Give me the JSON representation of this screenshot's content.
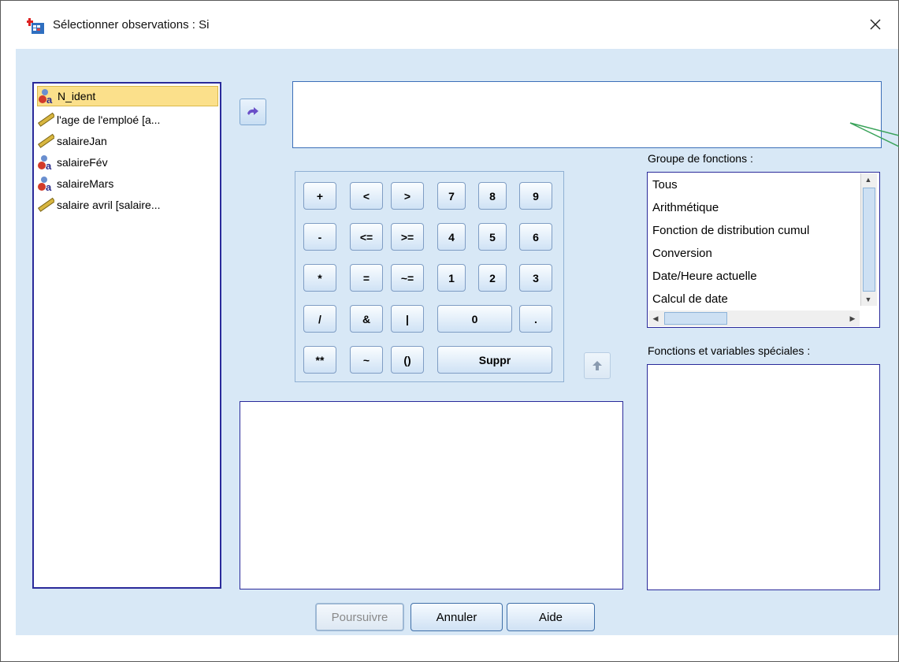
{
  "window": {
    "title": "Sélectionner observations : Si",
    "close_icon": "close-icon"
  },
  "variables": [
    {
      "label": "N_ident",
      "icon": "nominal-variable-icon",
      "selected": true
    },
    {
      "label": "l'age de l'emploé [a...",
      "icon": "scale-ruler-icon",
      "selected": false
    },
    {
      "label": "salaireJan",
      "icon": "scale-ruler-icon",
      "selected": false
    },
    {
      "label": "salaireFév",
      "icon": "nominal-variable-icon",
      "selected": false
    },
    {
      "label": "salaireMars",
      "icon": "nominal-variable-icon",
      "selected": false
    },
    {
      "label": "salaire avril [salaire...",
      "icon": "scale-ruler-icon",
      "selected": false
    }
  ],
  "expression": {
    "value": ""
  },
  "keypad": {
    "row1": [
      "+",
      "<",
      ">",
      "7",
      "8",
      "9"
    ],
    "row2": [
      "-",
      "<=",
      ">=",
      "4",
      "5",
      "6"
    ],
    "row3": [
      "*",
      "=",
      "~=",
      "1",
      "2",
      "3"
    ],
    "row4": [
      "/",
      "&",
      "|",
      "0",
      "."
    ],
    "row5": [
      "**",
      "~",
      "()",
      "Suppr"
    ]
  },
  "function_group": {
    "label": "Groupe de fonctions :",
    "items": [
      "Tous",
      "Arithmétique",
      "Fonction de distribution cumul",
      "Conversion",
      "Date/Heure actuelle",
      "Calcul de date"
    ]
  },
  "special_functions": {
    "label": "Fonctions et variables spéciales :"
  },
  "buttons": {
    "continue": "Poursuivre",
    "cancel": "Annuler",
    "help": "Aide"
  },
  "colors": {
    "client_bg": "#d8e8f6",
    "selection": "#fbe08b",
    "list_border": "#2a2a9a",
    "callout": "#3aa35a"
  }
}
